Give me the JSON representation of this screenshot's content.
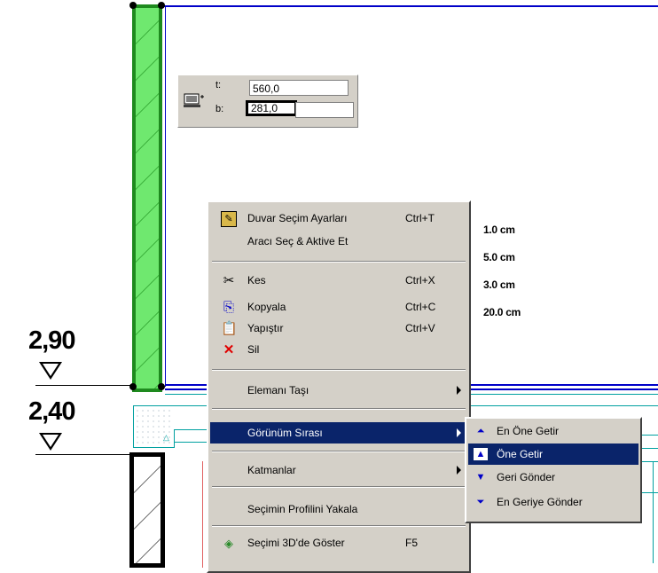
{
  "coord_panel": {
    "t_label": "t:",
    "t_value": "560,0",
    "b_label": "b:",
    "b_value": "281,0"
  },
  "levels": [
    {
      "value": "2,90"
    },
    {
      "value": "2,40"
    }
  ],
  "width_labels": [
    "1.0 cm",
    "5.0 cm",
    "3.0 cm",
    "20.0 cm"
  ],
  "context_menu": {
    "items": [
      {
        "label": "Duvar Seçim Ayarları",
        "shortcut": "Ctrl+T",
        "icon": "wall-settings-icon"
      },
      {
        "label": "Aracı Seç & Aktive Et",
        "shortcut": ""
      },
      {
        "label": "Kes",
        "shortcut": "Ctrl+X",
        "icon": "scissors-icon"
      },
      {
        "label": "Kopyala",
        "shortcut": "Ctrl+C",
        "icon": "copy-icon"
      },
      {
        "label": "Yapıştır",
        "shortcut": "Ctrl+V",
        "icon": "paste-icon"
      },
      {
        "label": "Sil",
        "shortcut": "",
        "icon": "delete-icon"
      },
      {
        "label": "Elemanı Taşı",
        "has_submenu": true
      },
      {
        "label": "Görünüm Sırası",
        "has_submenu": true,
        "selected": true
      },
      {
        "label": "Katmanlar",
        "has_submenu": true
      },
      {
        "label": "Seçimin Profilini Yakala"
      },
      {
        "label": "Seçimi 3D'de Göster",
        "shortcut": "F5",
        "icon": "show-3d-icon"
      }
    ]
  },
  "submenu": {
    "items": [
      {
        "label": "En Öne Getir",
        "icon": "bring-to-front-icon"
      },
      {
        "label": "Öne Getir",
        "icon": "bring-forward-icon",
        "selected": true
      },
      {
        "label": "Geri Gönder",
        "icon": "send-backward-icon"
      },
      {
        "label": "En Geriye Gönder",
        "icon": "send-to-back-icon"
      }
    ]
  },
  "colors": {
    "wall_fill": "#6fe86f",
    "wall_border": "#1e8a1e",
    "menu_bg": "#d4d0c8",
    "highlight": "#0a246a",
    "plan_line_blue": "#0000c8",
    "plan_line_cyan": "#00a0a0",
    "plan_line_red": "#e06060"
  }
}
